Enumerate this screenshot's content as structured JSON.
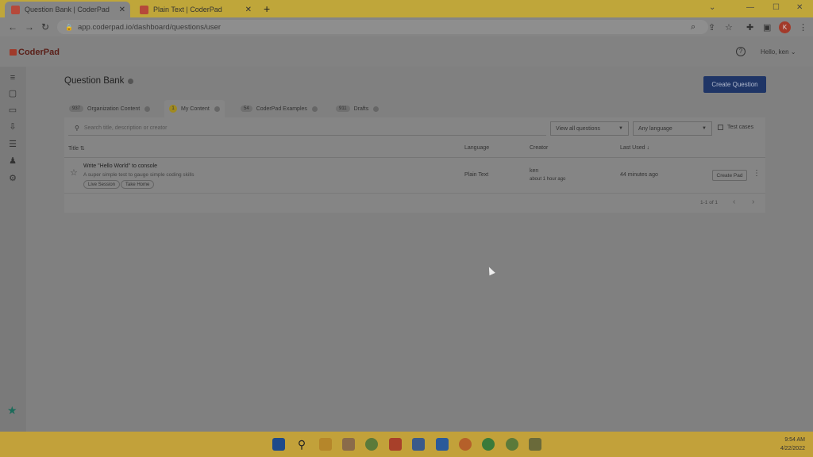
{
  "browser": {
    "tabs": [
      {
        "label": "Question Bank | CoderPad"
      },
      {
        "label": "Plain Text | CoderPad"
      }
    ],
    "new_tab": "+",
    "url": "app.coderpad.io/dashboard/questions/user",
    "profile_initial": "K"
  },
  "app": {
    "logo": "CoderPad",
    "user_menu": "Hello, ken"
  },
  "page": {
    "title": "Question Bank",
    "create_button": "Create Question",
    "tabs": [
      {
        "count": "937",
        "label": "Organization Content"
      },
      {
        "count": "1",
        "label": "My Content"
      },
      {
        "count": "54",
        "label": "CoderPad Examples"
      },
      {
        "count": "911",
        "label": "Drafts"
      }
    ],
    "search_placeholder": "Search title, description or creator",
    "filter_questions": "View all questions",
    "filter_language": "Any language",
    "test_cases": "Test cases",
    "columns": {
      "title": "Title",
      "language": "Language",
      "creator": "Creator",
      "last_used": "Last Used"
    },
    "rows": [
      {
        "title": "Write \"Hello World\" to console",
        "description": "A super simple test to gauge simple coding skills",
        "chips": [
          "Live Session",
          "Take Home"
        ],
        "language": "Plain Text",
        "creator": "ken",
        "created": "about 1 hour ago",
        "last_used": "44 minutes ago",
        "action": "Create Pad"
      }
    ],
    "pagination": "1-1 of 1"
  },
  "taskbar": {
    "time": "9:54 AM",
    "date": "4/22/2022"
  },
  "colors": {
    "tabbar": "#bfa63a",
    "primary_button": "#1f3566",
    "logo_red": "#a03a2a",
    "star_green": "#1b6b5a"
  }
}
